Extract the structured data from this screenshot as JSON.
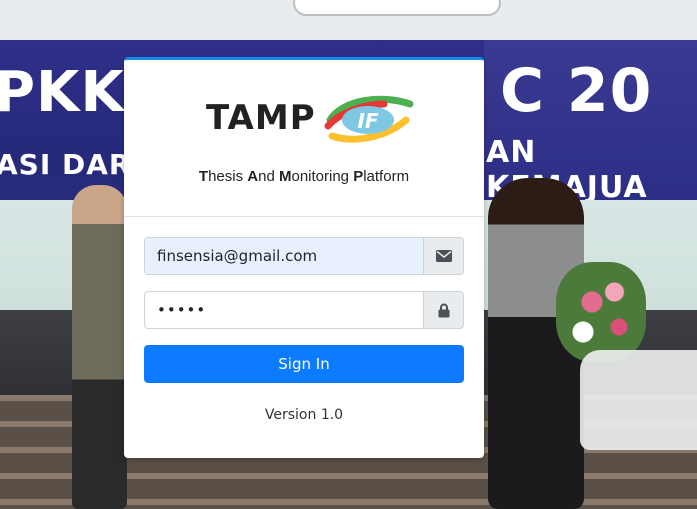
{
  "background": {
    "banner_text_left": "PKK",
    "banner_text_left_sub": "ASI DAR",
    "banner_text_right": "C 20",
    "banner_text_right_sub": "AN KEMAJUA"
  },
  "brand": {
    "name": "TAMP",
    "logo_text": "IF",
    "tagline": [
      {
        "bold": "T",
        "rest": "hesis "
      },
      {
        "bold": "A",
        "rest": "nd "
      },
      {
        "bold": "M",
        "rest": "onitoring "
      },
      {
        "bold": "P",
        "rest": "latform"
      }
    ]
  },
  "login": {
    "email_value": "finsensia@gmail.com",
    "email_icon": "envelope-icon",
    "password_value": "•••••",
    "password_icon": "lock-icon",
    "signin_label": "Sign In",
    "version": "Version 1.0"
  },
  "colors": {
    "accent": "#0d7bff",
    "card_top_border": "#1e88e5"
  }
}
